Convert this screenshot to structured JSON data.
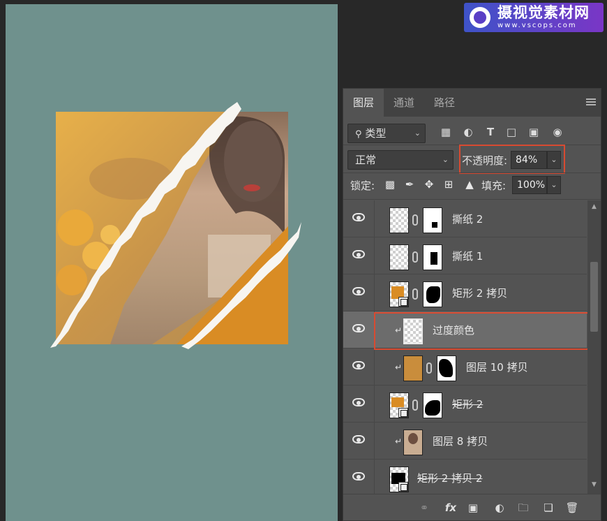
{
  "watermark": {
    "title": "摄视觉素材网",
    "url": "www.vscops.com"
  },
  "panel": {
    "tabs": [
      "图层",
      "通道",
      "路径"
    ],
    "active_tab": "图层",
    "filter": {
      "kind_label": "类型"
    },
    "blend_mode": "正常",
    "opacity_label": "不透明度:",
    "opacity_value": "84%",
    "lock_label": "锁定:",
    "fill_label": "填充:",
    "fill_value": "100%",
    "layers": [
      {
        "name": "撕纸 2",
        "visible": true,
        "has_mask": true,
        "clipped": false,
        "strikethrough": false,
        "selected": false
      },
      {
        "name": "撕纸 1",
        "visible": true,
        "has_mask": true,
        "clipped": false,
        "strikethrough": false,
        "selected": false
      },
      {
        "name": "矩形 2 拷贝",
        "visible": true,
        "has_mask": true,
        "clipped": false,
        "strikethrough": false,
        "selected": false
      },
      {
        "name": "过度颜色",
        "visible": true,
        "has_mask": false,
        "clipped": true,
        "strikethrough": false,
        "selected": true
      },
      {
        "name": "图层 10 拷贝",
        "visible": true,
        "has_mask": true,
        "clipped": true,
        "strikethrough": false,
        "selected": false
      },
      {
        "name": "矩形 2",
        "visible": true,
        "has_mask": true,
        "clipped": false,
        "strikethrough": true,
        "selected": false
      },
      {
        "name": "图层 8 拷贝",
        "visible": true,
        "has_mask": false,
        "clipped": true,
        "strikethrough": false,
        "selected": false
      },
      {
        "name": "矩形 2 拷贝 2",
        "visible": true,
        "has_mask": false,
        "clipped": false,
        "strikethrough": true,
        "selected": false
      }
    ]
  },
  "colors": {
    "canvas_bg": "#6f918d",
    "orange": "#d98c24",
    "highlight": "#d84a31",
    "panel_bg": "#535353"
  },
  "icons": {
    "filter": [
      "image-filter-icon",
      "adjustment-filter-icon",
      "type-filter-icon",
      "shape-filter-icon",
      "smart-object-filter-icon",
      "filter-toggle-icon"
    ],
    "lock": [
      "lock-pixels-icon",
      "lock-brush-icon",
      "lock-position-icon",
      "lock-artboard-icon",
      "lock-all-icon"
    ],
    "bottom": [
      "link-layers-icon",
      "fx-icon",
      "add-mask-icon",
      "adjustment-layer-icon",
      "new-group-icon",
      "new-layer-icon",
      "delete-layer-icon"
    ]
  }
}
